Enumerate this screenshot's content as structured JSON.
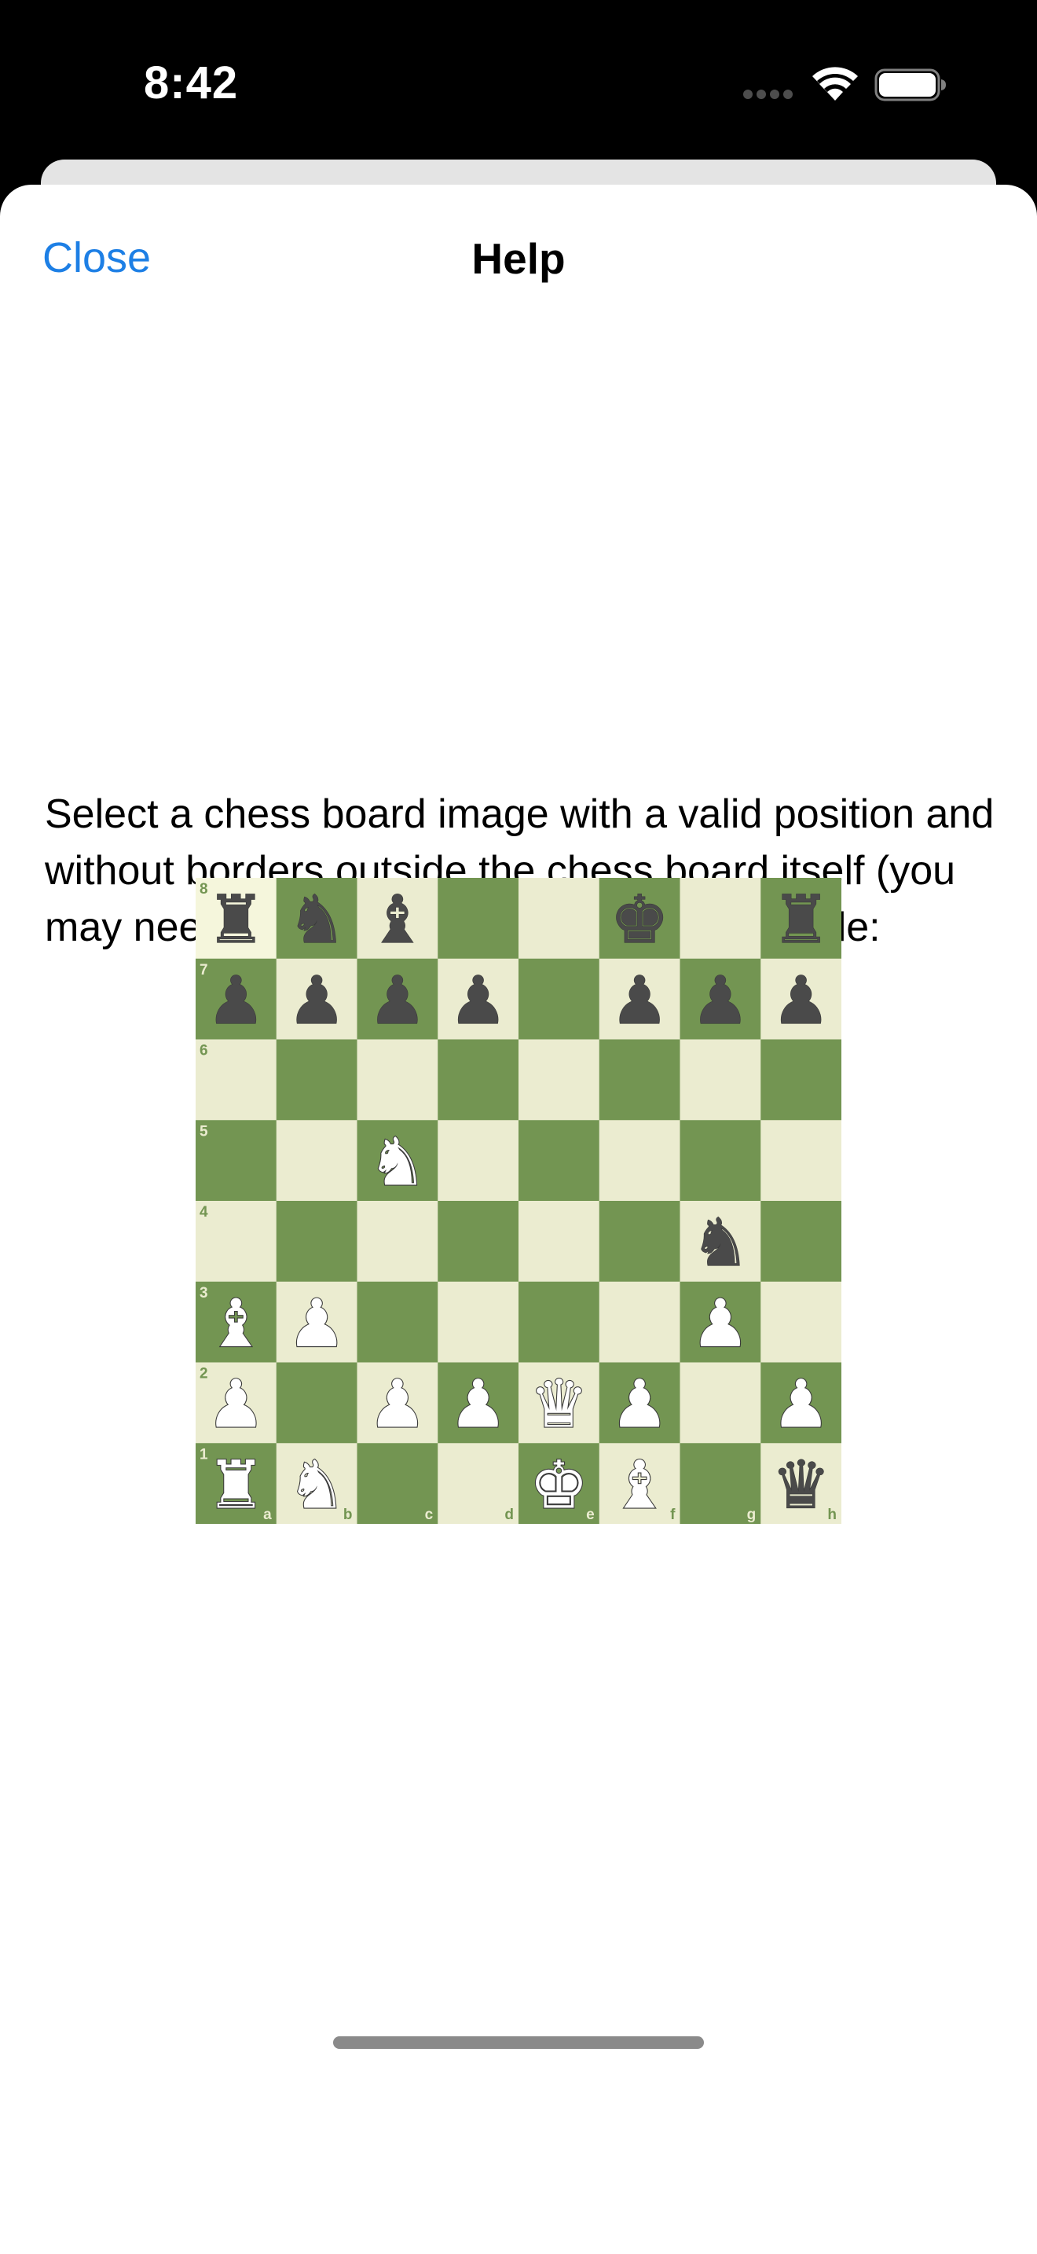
{
  "status_bar": {
    "time": "8:42"
  },
  "header": {
    "close_label": "Close",
    "title": "Help"
  },
  "body": {
    "help_text": "Select a chess board image with a valid position and without borders outside the chess board itself (you may need to crop it); like this one for example:"
  },
  "board": {
    "colors": {
      "light": "#ebecd0",
      "dark": "#739552",
      "highlight": "#f5f6dc",
      "white_piece": "#ffffff",
      "black_piece": "#4a4a4a",
      "outline": "#3a3a3a"
    },
    "rank_labels": [
      "8",
      "7",
      "6",
      "5",
      "4",
      "3",
      "2",
      "1"
    ],
    "file_labels": [
      "a",
      "b",
      "c",
      "d",
      "e",
      "f",
      "g",
      "h"
    ],
    "ranks": [
      [
        "r",
        "n",
        "b",
        "",
        "",
        "k",
        "",
        "r"
      ],
      [
        "p",
        "p",
        "p",
        "p",
        "",
        "p",
        "p",
        "p"
      ],
      [
        "",
        "",
        "",
        "",
        "",
        "",
        "",
        ""
      ],
      [
        "",
        "",
        "N",
        "",
        "",
        "",
        "",
        ""
      ],
      [
        "",
        "",
        "",
        "",
        "",
        "",
        "n",
        ""
      ],
      [
        "B",
        "P",
        "",
        "",
        "",
        "",
        "P",
        ""
      ],
      [
        "P",
        "",
        "P",
        "P",
        "Q",
        "P",
        "",
        "P"
      ],
      [
        "R",
        "N",
        "",
        "",
        "K",
        "B",
        "",
        "q"
      ]
    ],
    "piece_glyphs": {
      "k": "♚",
      "q": "♛",
      "r": "♜",
      "b": "♝",
      "n": "♞",
      "p": "♟"
    }
  }
}
